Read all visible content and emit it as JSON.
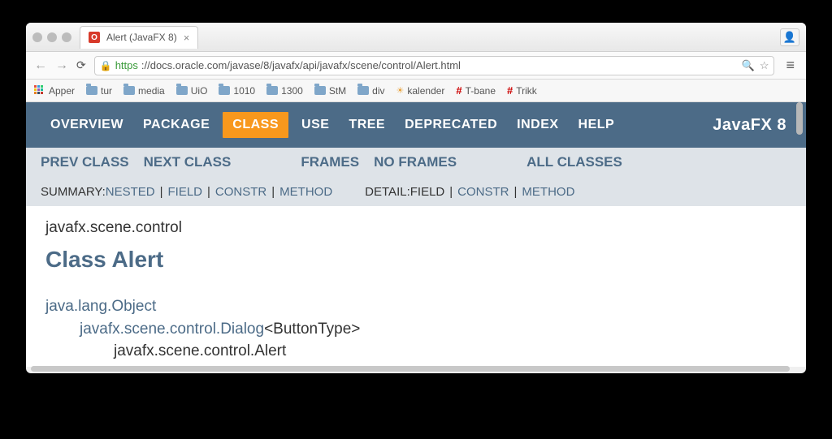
{
  "tab": {
    "title": "Alert (JavaFX 8)"
  },
  "url": {
    "secure_part": "https",
    "rest": "://docs.oracle.com/javase/8/javafx/api/javafx/scene/control/Alert.html"
  },
  "bookmarks": [
    "Apper",
    "tur",
    "media",
    "UiO",
    "1010",
    "1300",
    "StM",
    "div",
    "kalender",
    "T-bane",
    "Trikk"
  ],
  "brand": "JavaFX 8",
  "topnav": {
    "overview": "OVERVIEW",
    "package": "PACKAGE",
    "class": "CLASS",
    "use": "USE",
    "tree": "TREE",
    "deprecated": "DEPRECATED",
    "index": "INDEX",
    "help": "HELP"
  },
  "subnav": {
    "prev": "PREV CLASS",
    "next": "NEXT CLASS",
    "frames": "FRAMES",
    "noframes": "NO FRAMES",
    "all": "ALL CLASSES"
  },
  "summary": {
    "label": "SUMMARY: ",
    "nested": "NESTED",
    "field": "FIELD",
    "constr": "CONSTR",
    "method": "METHOD"
  },
  "detail": {
    "label": "DETAIL: ",
    "field": "FIELD",
    "constr": "CONSTR",
    "method": "METHOD"
  },
  "package_path": "javafx.scene.control",
  "class_title": "Class Alert",
  "hierarchy": {
    "l0": "java.lang.Object",
    "l1_link": "javafx.scene.control.Dialog",
    "l1_generic": "<ButtonType>",
    "l2": "javafx.scene.control.Alert"
  }
}
